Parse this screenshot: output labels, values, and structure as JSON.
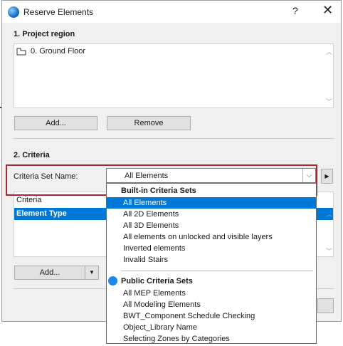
{
  "window": {
    "title": "Reserve Elements",
    "help_label": "?",
    "close_label": "✕"
  },
  "project_region": {
    "title": "1. Project region",
    "items": [
      {
        "label": "0. Ground Floor"
      }
    ],
    "add_label": "Add...",
    "remove_label": "Remove"
  },
  "criteria": {
    "title": "2. Criteria",
    "set_name_label": "Criteria Set Name:",
    "set_name_value": "All Elements",
    "list_header": "Criteria",
    "list_rows": [
      {
        "label": "Element Type"
      }
    ],
    "add_label": "Add..."
  },
  "dropdown": {
    "builtin_header": "Built-in Criteria Sets",
    "builtin_items": [
      "All Elements",
      "All 2D Elements",
      "All 3D Elements",
      "All elements on unlocked and visible layers",
      "Inverted elements",
      "Invalid Stairs"
    ],
    "public_header": "Public Criteria Sets",
    "public_items": [
      "All MEP Elements",
      "All Modeling Elements",
      "BWT_Component Schedule Checking",
      "Object_Library Name",
      "Selecting Zones by Categories"
    ]
  },
  "colors": {
    "accent": "#0078d7",
    "highlight_border": "#b3232b",
    "public_dot": "#1e88e5"
  }
}
